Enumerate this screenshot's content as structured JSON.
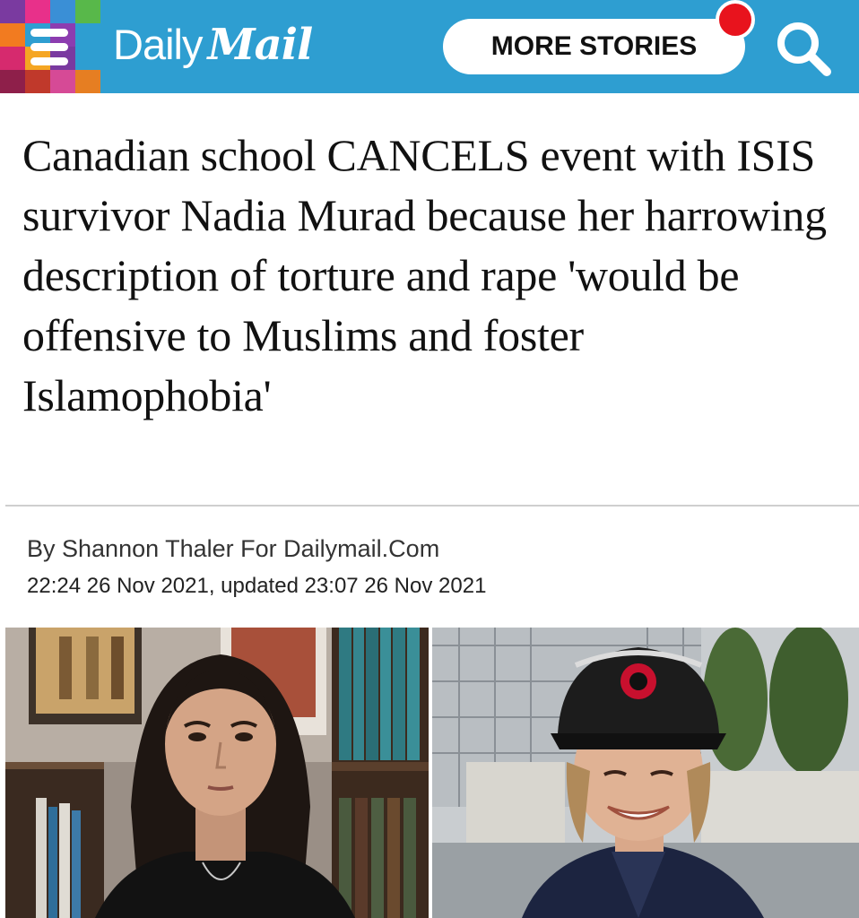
{
  "header": {
    "logo_daily": "Daily",
    "logo_mail": "Mail",
    "more_stories_label": "MORE STORIES",
    "accent_color": "#2e9ed1",
    "notification_color": "#e8131d",
    "menu_icon": "hamburger-menu-icon",
    "search_icon": "search-icon"
  },
  "article": {
    "headline": "Canadian school CANCELS event with ISIS survivor Nadia Murad because her harrowing description of torture and rape 'would be offensive to Muslims and foster Islamophobia'",
    "byline": "By Shannon Thaler For Dailymail.Com",
    "dateline": "22:24 26 Nov 2021, updated 23:07 26 Nov 2021"
  },
  "images": {
    "left_caption": "",
    "right_caption": ""
  }
}
